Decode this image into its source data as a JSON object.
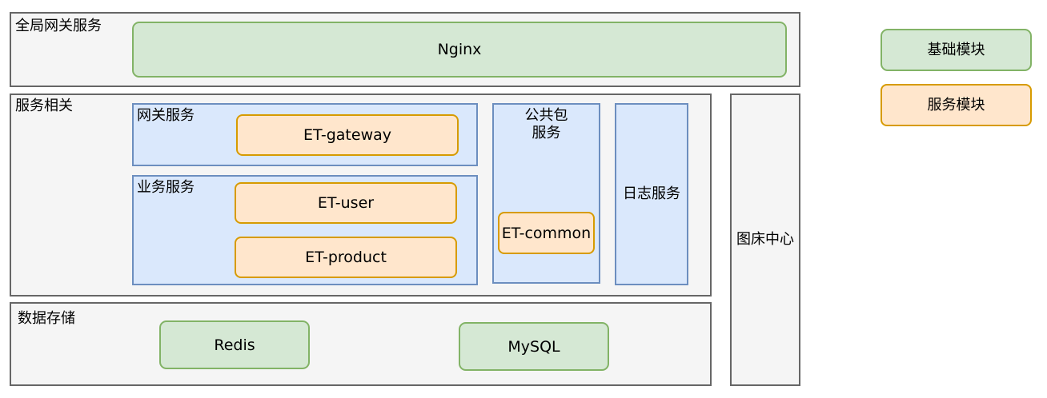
{
  "gateway_layer": {
    "title": "全局网关服务",
    "nginx": "Nginx"
  },
  "service_layer": {
    "title": "服务相关",
    "gateway_group": {
      "title": "网关服务",
      "node": "ET-gateway"
    },
    "business_group": {
      "title": "业务服务",
      "nodes": [
        "ET-user",
        "ET-product"
      ]
    },
    "common_group": {
      "title_line1": "公共包",
      "title_line2": "服务",
      "node": "ET-common"
    },
    "log_group": {
      "title": "日志服务"
    }
  },
  "storage_layer": {
    "title": "数据存储",
    "nodes": [
      "Redis",
      "MySQL"
    ]
  },
  "image_center": {
    "title": "图床中心"
  },
  "legend": {
    "basic": "基础模块",
    "service": "服务模块"
  },
  "colors": {
    "basic_fill": "#d5e8d4",
    "basic_border": "#82b366",
    "service_fill": "#ffe6cc",
    "service_border": "#d79b00",
    "group_fill": "#dae8fc",
    "group_border": "#6c8ebf",
    "layer_fill": "#f5f5f5",
    "layer_border": "#666666"
  }
}
